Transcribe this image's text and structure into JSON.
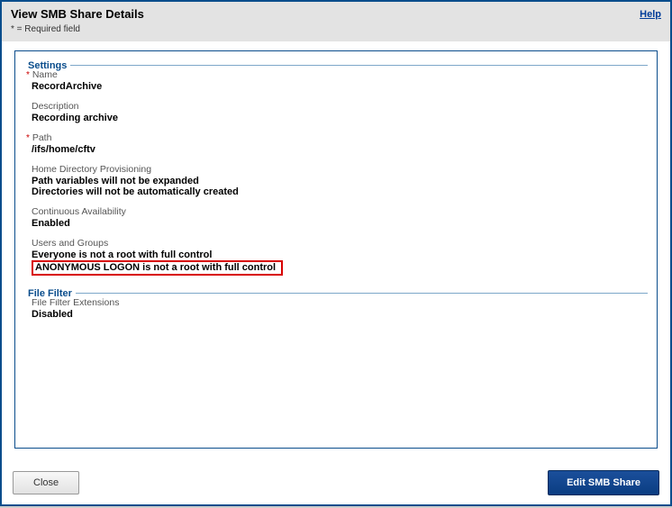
{
  "header": {
    "title": "View SMB Share Details",
    "required_note": "* = Required field",
    "help_label": "Help"
  },
  "sections": {
    "settings": {
      "legend": "Settings",
      "name": {
        "label": "Name",
        "value": "RecordArchive",
        "required": true
      },
      "description": {
        "label": "Description",
        "value": "Recording archive"
      },
      "path": {
        "label": "Path",
        "value": "/ifs/home/cftv",
        "required": true
      },
      "homedir": {
        "label": "Home Directory Provisioning",
        "value1": "Path variables will not be expanded",
        "value2": "Directories will not be automatically created"
      },
      "ca": {
        "label": "Continuous Availability",
        "value": "Enabled"
      },
      "users_groups": {
        "label": "Users and Groups",
        "value1": "Everyone is not a root with full control",
        "value2": "ANONYMOUS LOGON is not a root with full control"
      }
    },
    "file_filter": {
      "legend": "File Filter",
      "ext": {
        "label": "File Filter Extensions",
        "value": "Disabled"
      }
    }
  },
  "footer": {
    "close_label": "Close",
    "edit_label": "Edit SMB Share"
  }
}
